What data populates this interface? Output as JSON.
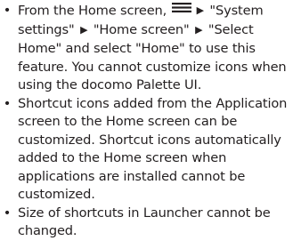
{
  "notes": {
    "bullet": "•",
    "item1": {
      "text_a": "From the Home screen, ",
      "arrow": "▶",
      "text_b": " \"System settings\" ",
      "text_c": " \"Home screen\" ",
      "text_d": " \"Select Home\" and select \"Home\" to use this feature. You cannot customize icons when using the docomo Palette UI."
    },
    "item2": "Shortcut icons added from the Application screen to the Home screen can be customized. Shortcut icons automatically added to the Home screen when applications are installed cannot be customized.",
    "item3": "Size of shortcuts in Launcher cannot be changed."
  },
  "icons": {
    "menu": "menu-icon"
  },
  "colors": {
    "text": "#231f20",
    "background": "#ffffff"
  }
}
